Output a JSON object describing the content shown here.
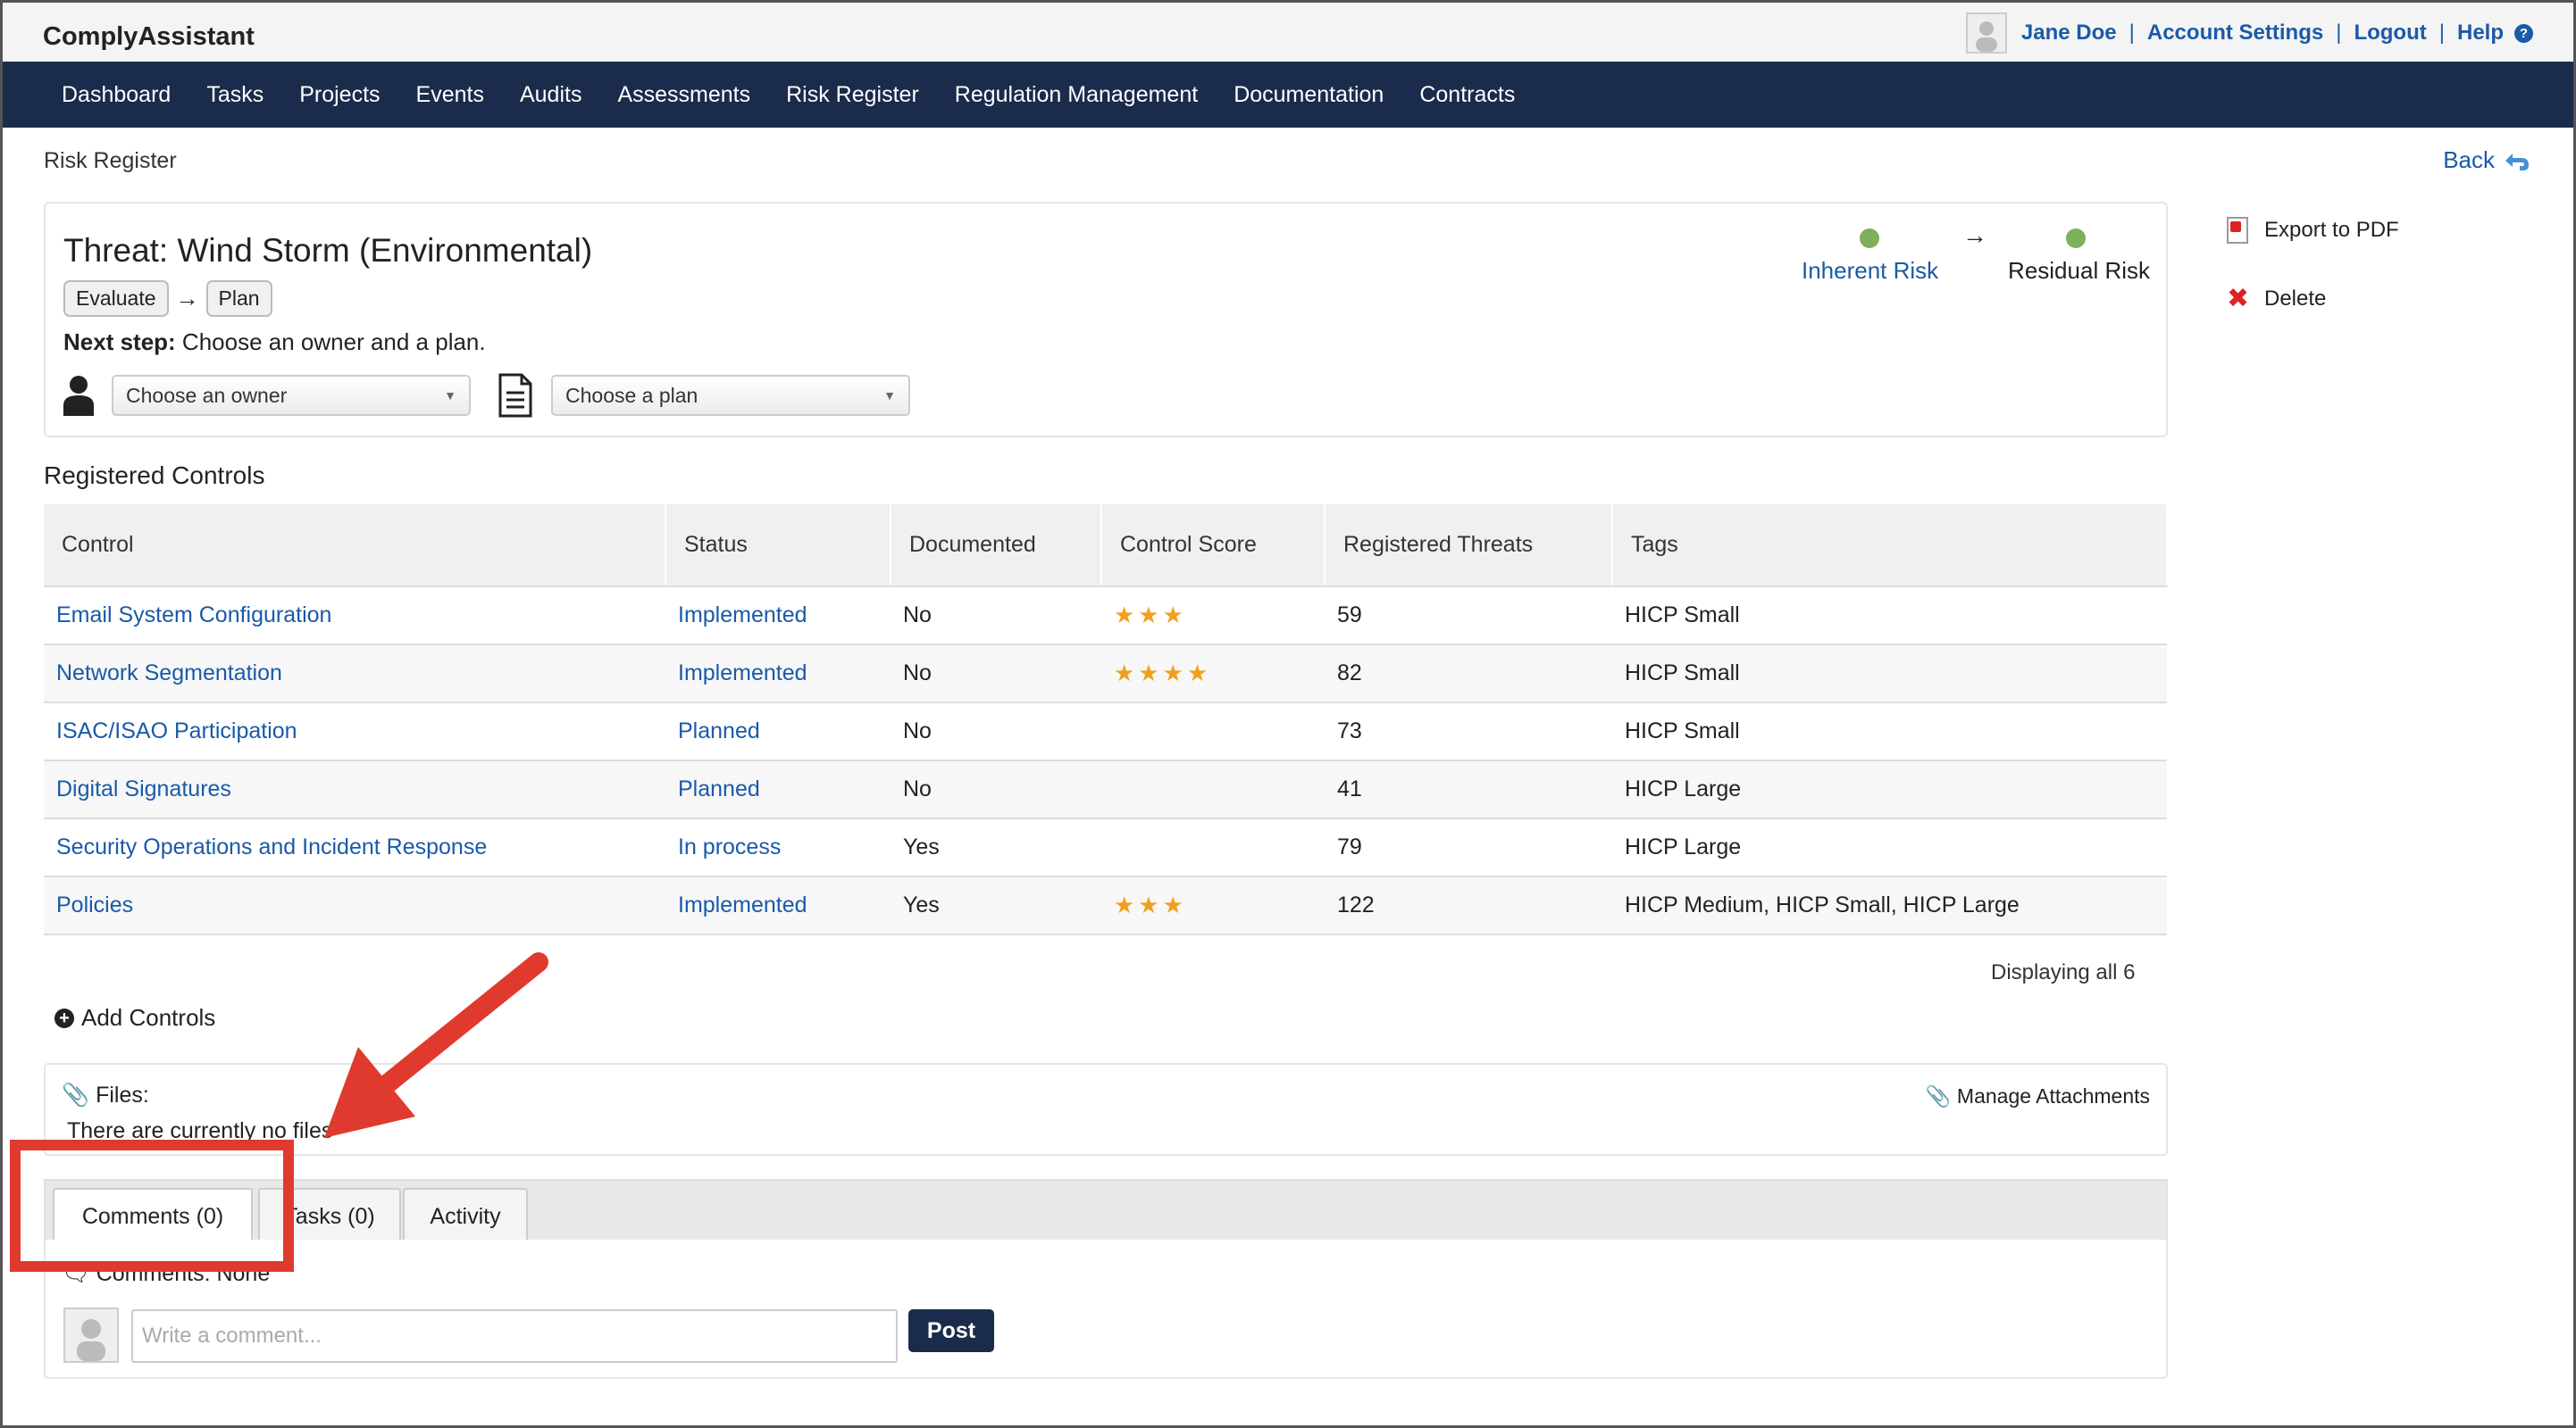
{
  "app": {
    "title": "ComplyAssistant"
  },
  "user": {
    "name": "Jane Doe",
    "account_settings": "Account Settings",
    "logout": "Logout",
    "help": "Help",
    "separator": "|"
  },
  "nav": [
    "Dashboard",
    "Tasks",
    "Projects",
    "Events",
    "Audits",
    "Assessments",
    "Risk Register",
    "Regulation Management",
    "Documentation",
    "Contracts"
  ],
  "breadcrumb": "Risk Register",
  "back_label": "Back",
  "threat": {
    "title": "Threat: Wind Storm (Environmental)",
    "workflow": [
      "Evaluate",
      "Plan"
    ],
    "arrow": "→",
    "next_step_label": "Next step:",
    "next_step_text": " Choose an owner and a plan.",
    "owner_placeholder": "Choose an owner",
    "plan_placeholder": "Choose a plan",
    "caret": "▼"
  },
  "risk": {
    "inherent_label": "Inherent Risk",
    "residual_label": "Residual Risk",
    "arrow": "→",
    "inherent_color": "#7cb05a",
    "residual_color": "#7cb05a"
  },
  "side_actions": {
    "export_pdf": "Export to PDF",
    "delete": "Delete"
  },
  "controls": {
    "title": "Registered Controls",
    "columns": [
      "Control",
      "Status",
      "Documented",
      "Control Score",
      "Registered Threats",
      "Tags"
    ],
    "rows": [
      {
        "control": "Email System Configuration",
        "status": "Implemented",
        "documented": "No",
        "score": 3,
        "threats": "59",
        "tags": "HICP Small"
      },
      {
        "control": "Network Segmentation",
        "status": "Implemented",
        "documented": "No",
        "score": 4,
        "threats": "82",
        "tags": "HICP Small"
      },
      {
        "control": "ISAC/ISAO Participation",
        "status": "Planned",
        "documented": "No",
        "score": 0,
        "threats": "73",
        "tags": "HICP Small"
      },
      {
        "control": "Digital Signatures",
        "status": "Planned",
        "documented": "No",
        "score": 0,
        "threats": "41",
        "tags": "HICP Large"
      },
      {
        "control": "Security Operations and Incident Response",
        "status": "In process",
        "documented": "Yes",
        "score": 0,
        "threats": "79",
        "tags": "HICP Large"
      },
      {
        "control": "Policies",
        "status": "Implemented",
        "documented": "Yes",
        "score": 3,
        "threats": "122",
        "tags": "HICP Medium, HICP Small, HICP Large"
      }
    ],
    "display_all": "Displaying all 6",
    "add_controls": "Add Controls"
  },
  "files": {
    "label": "Files:",
    "empty": "There are currently no files",
    "manage": "Manage Attachments"
  },
  "tabs": [
    "Comments (0)",
    "Tasks (0)",
    "Activity"
  ],
  "comments": {
    "none": "Comments: None",
    "placeholder": "Write a comment...",
    "post": "Post"
  },
  "annotation": {
    "color": "#e03a2e"
  }
}
